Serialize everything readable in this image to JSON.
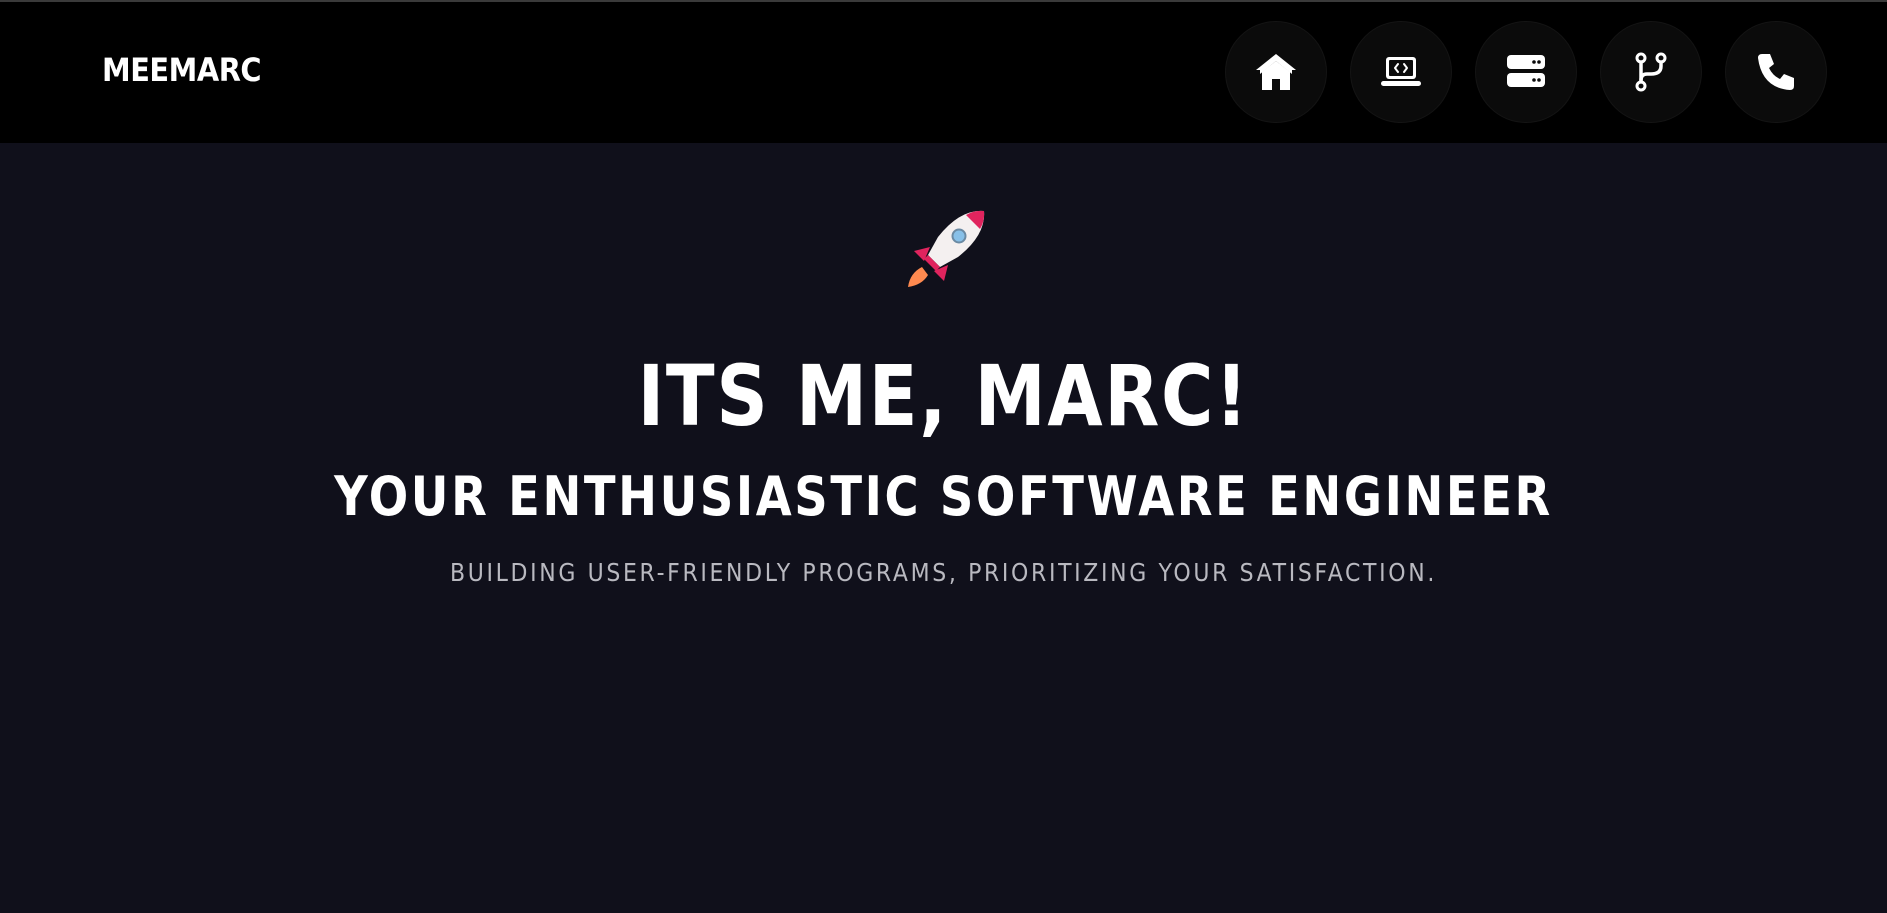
{
  "header": {
    "brand": "MEEMARC",
    "nav": [
      {
        "icon": "home-icon"
      },
      {
        "icon": "laptop-code-icon"
      },
      {
        "icon": "server-icon"
      },
      {
        "icon": "code-branch-icon"
      },
      {
        "icon": "phone-icon"
      }
    ]
  },
  "hero": {
    "icon": "rocket-icon",
    "title": "ITS ME, MARC!",
    "subtitle": "YOUR ENTHUSIASTIC SOFTWARE ENGINEER",
    "tagline": "BUILDING USER-FRIENDLY PROGRAMS, PRIORITIZING YOUR SATISFACTION."
  },
  "colors": {
    "header_bg": "#000000",
    "page_bg": "#10101b",
    "text": "#ffffff",
    "tagline": "#b9b9c0",
    "rocket_body": "#f4f0f0",
    "rocket_accent": "#e0245e",
    "rocket_flame": "#ff8a50",
    "rocket_window": "#88c0e8"
  }
}
